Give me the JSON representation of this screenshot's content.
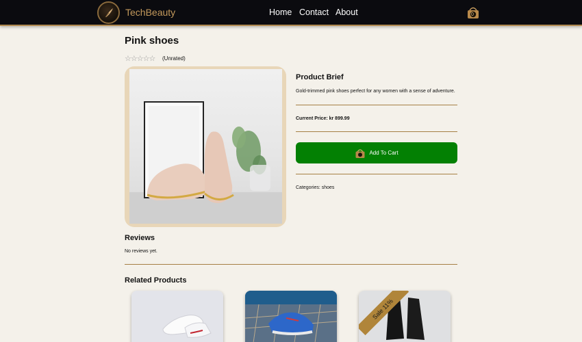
{
  "header": {
    "brand": "TechBeauty",
    "nav": [
      "Home",
      "Contact",
      "About"
    ],
    "cart_count": "0",
    "accent": "#c49a5c"
  },
  "product": {
    "title": "Pink shoes",
    "rating": 0,
    "rating_text": "(Unrated)",
    "brief_title": "Product Brief",
    "brief_text": "Gold-trimmed pink shoes perfect for any women with a sense of adventure.",
    "price": "Current Price: kr 899.99",
    "add_to_cart": "Add To Cart",
    "categories": "Categories: shoes"
  },
  "reviews": {
    "title": "Reviews",
    "empty": "No reviews yet."
  },
  "related": {
    "title": "Related Products",
    "items": [
      {
        "image": "white-sneakers"
      },
      {
        "image": "blue-sneakers"
      },
      {
        "image": "black-boots",
        "badge": "Sale 11%"
      }
    ]
  },
  "colors": {
    "header_bg": "#0b0b0f",
    "button_green": "#038003",
    "divider": "#a57f43",
    "background": "#f4f1ea"
  }
}
